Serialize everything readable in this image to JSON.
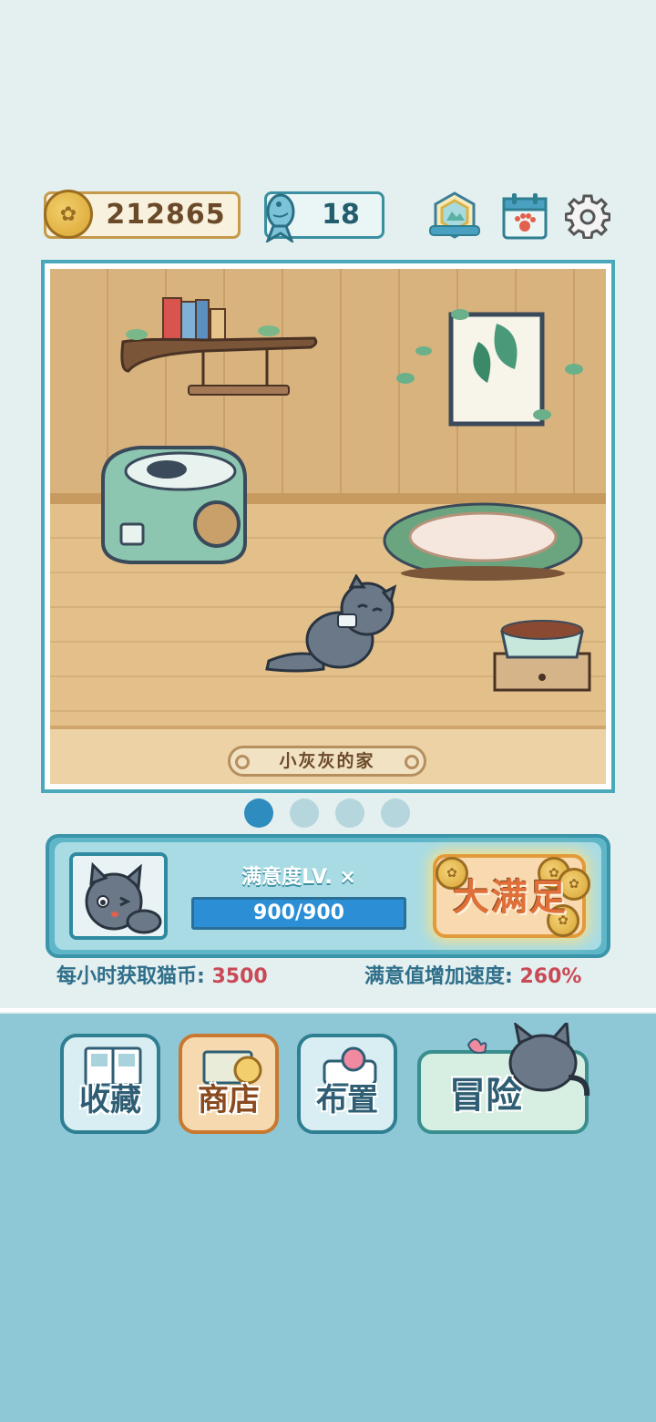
{
  "currency": {
    "coins": "212865",
    "fish": "18"
  },
  "header_icons": [
    "badge-icon",
    "calendar-paw-icon",
    "gear-icon"
  ],
  "room": {
    "name": "小灰灰的家",
    "page_count": 4,
    "active_page": 1
  },
  "status": {
    "satisfaction_label": "满意度LV. ×",
    "satisfaction_value": "900/900",
    "satisfaction_progress": 1.0,
    "big_button_label": "大满足",
    "coins_per_hour_label": "每小时获取猫币: ",
    "coins_per_hour_value": "3500",
    "speed_label": "满意值增加速度: ",
    "speed_value": "260%"
  },
  "nav": {
    "collection": "收藏",
    "shop": "商店",
    "decorate": "布置",
    "adventure": "冒险"
  },
  "colors": {
    "background": "#e4eff0",
    "accent": "#4aa8bb",
    "value_red": "#c84a55",
    "bottom": "#8ec7d5"
  }
}
